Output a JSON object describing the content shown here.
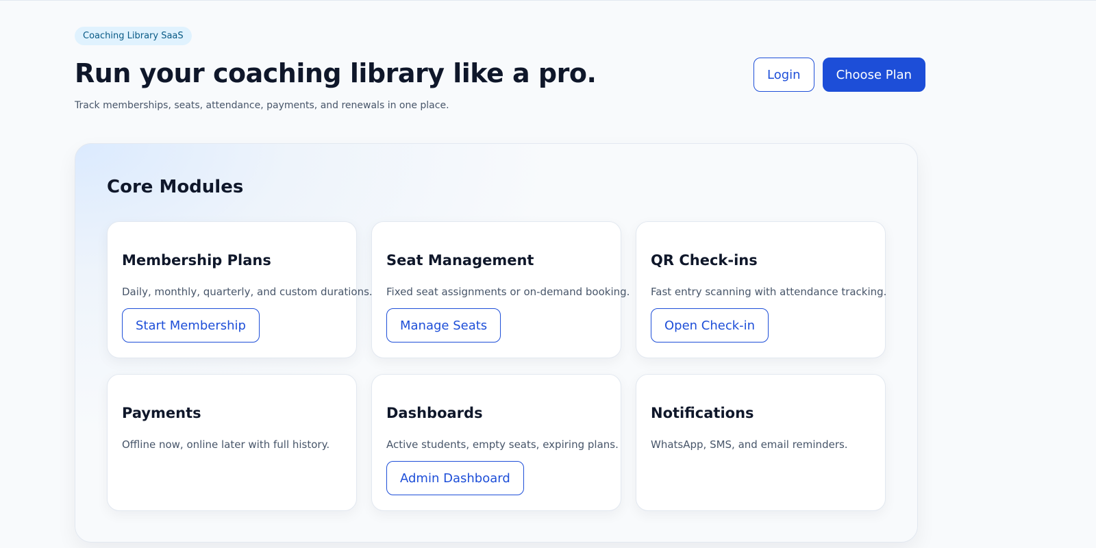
{
  "header": {
    "badge": "Coaching Library SaaS",
    "title": "Run your coaching library like a pro.",
    "subtitle": "Track memberships, seats, attendance, payments, and renewals in one place.",
    "login_label": "Login",
    "choose_plan_label": "Choose Plan"
  },
  "modules": {
    "title": "Core Modules",
    "cards": [
      {
        "title": "Membership Plans",
        "description": "Daily, monthly, quarterly, and custom durations.",
        "button": "Start Membership"
      },
      {
        "title": "Seat Management",
        "description": "Fixed seat assignments or on-demand booking.",
        "button": "Manage Seats"
      },
      {
        "title": "QR Check-ins",
        "description": "Fast entry scanning with attendance tracking.",
        "button": "Open Check-in"
      },
      {
        "title": "Payments",
        "description": "Offline now, online later with full history."
      },
      {
        "title": "Dashboards",
        "description": "Active students, empty seats, expiring plans.",
        "button": "Admin Dashboard"
      },
      {
        "title": "Notifications",
        "description": "WhatsApp, SMS, and email reminders."
      }
    ]
  },
  "colors": {
    "accent": "#1d4ed8",
    "badge_bg": "#e0f2fe",
    "badge_text": "#075985",
    "text": "#0f172a",
    "muted": "#475569"
  }
}
